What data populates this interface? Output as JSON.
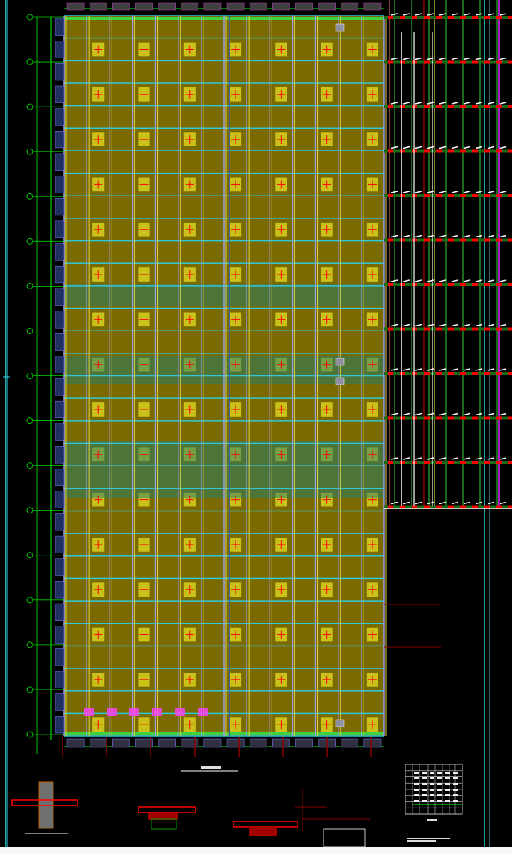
{
  "drawing": {
    "type": "CAD structural floor plan",
    "colors": {
      "background": "#000000",
      "slab_fill": "#7a6a00",
      "slab_highlight": "#d8d020",
      "grid_line": "#30c8d8",
      "column_line": "#9aa0e0",
      "axis_bubble": "#00d000",
      "beam_red": "#ff0000",
      "beam_green": "#1a6a1a",
      "beam_white": "#ffffff",
      "purple": "#a020c0",
      "dark_red": "#8a0000",
      "dim_line": "#00ff00"
    },
    "main_plan_rows": 16,
    "main_plan_cols": 14
  }
}
